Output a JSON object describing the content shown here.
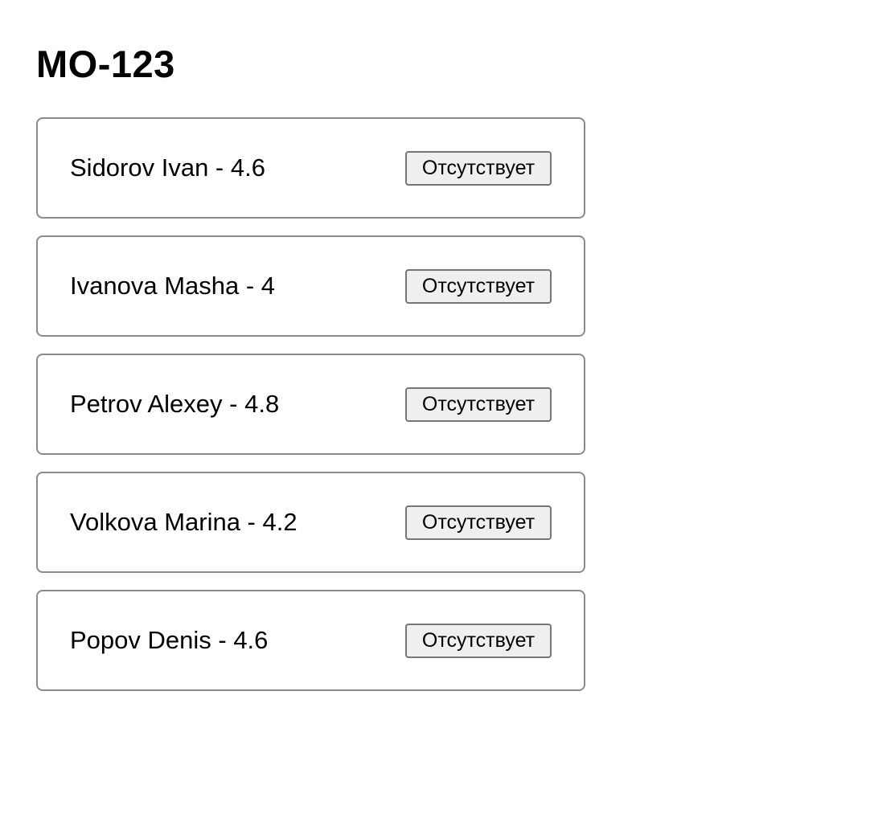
{
  "group": {
    "title": "MO-123"
  },
  "students": [
    {
      "label": "Sidorov Ivan - 4.6",
      "button_label": "Отсутствует"
    },
    {
      "label": "Ivanova Masha - 4",
      "button_label": "Отсутствует"
    },
    {
      "label": "Petrov Alexey - 4.8",
      "button_label": "Отсутствует"
    },
    {
      "label": "Volkova Marina - 4.2",
      "button_label": "Отсутствует"
    },
    {
      "label": "Popov Denis - 4.6",
      "button_label": "Отсутствует"
    }
  ]
}
